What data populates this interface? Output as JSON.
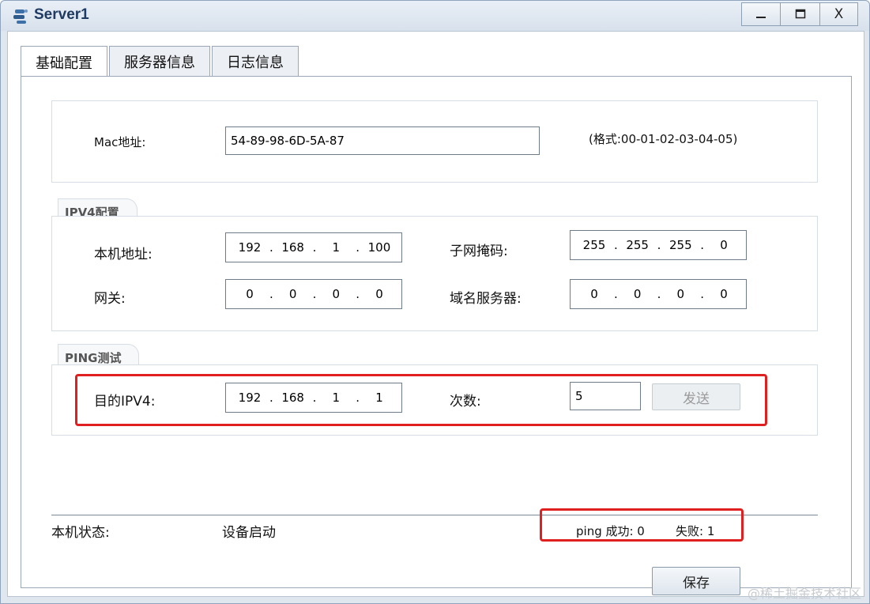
{
  "window": {
    "title": "Server1",
    "controls": {
      "minimize": "—",
      "maximize": "☐",
      "close": "X"
    }
  },
  "tabs": [
    {
      "label": "基础配置",
      "active": true
    },
    {
      "label": "服务器信息",
      "active": false
    },
    {
      "label": "日志信息",
      "active": false
    }
  ],
  "mac": {
    "label": "Mac地址:",
    "value": "54-89-98-6D-5A-87",
    "format_hint": "(格式:00-01-02-03-04-05)"
  },
  "ipv4": {
    "legend": "IPV4配置",
    "local_ip": {
      "label": "本机地址:",
      "octets": [
        "192",
        "168",
        "1",
        "100"
      ]
    },
    "subnet_mask": {
      "label": "子网掩码:",
      "octets": [
        "255",
        "255",
        "255",
        "0"
      ]
    },
    "gateway": {
      "label": "网关:",
      "octets": [
        "0",
        "0",
        "0",
        "0"
      ]
    },
    "dns": {
      "label": "域名服务器:",
      "octets": [
        "0",
        "0",
        "0",
        "0"
      ]
    }
  },
  "ping": {
    "legend": "PING测试",
    "target": {
      "label": "目的IPV4:",
      "octets": [
        "192",
        "168",
        "1",
        "1"
      ]
    },
    "count": {
      "label": "次数:",
      "value": "5"
    },
    "send_label": "发送"
  },
  "status": {
    "label": "本机状态:",
    "value": "设备启动",
    "ping_success": "ping 成功: 0",
    "ping_fail": "失败: 1"
  },
  "save_label": "保存",
  "watermark": "@稀土掘金技术社区",
  "colors": {
    "highlight": "#e02020",
    "title": "#1f3b63"
  }
}
